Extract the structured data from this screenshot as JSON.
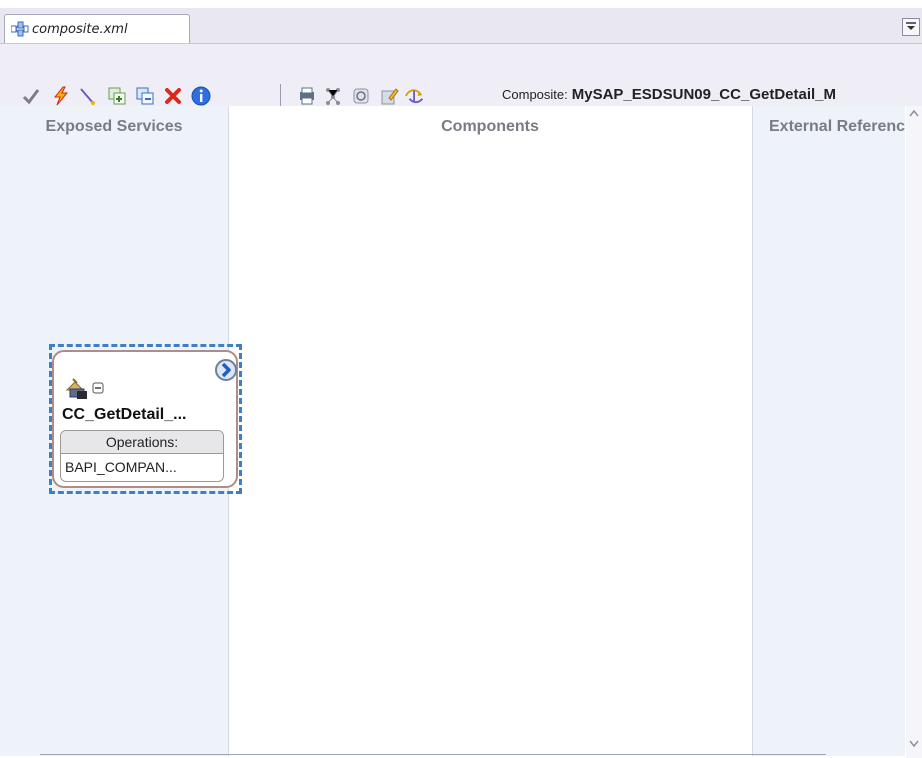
{
  "tab": {
    "label": "composite.xml"
  },
  "toolbar": {
    "composite_prefix": "Composite:",
    "composite_name": "MySAP_ESDSUN09_CC_GetDetail_M",
    "buttons": [
      {
        "icon": "check-icon"
      },
      {
        "icon": "lightning-icon"
      },
      {
        "icon": "wire-icon"
      },
      {
        "icon": "add-component-icon"
      },
      {
        "icon": "copy-icon"
      },
      {
        "icon": "delete-icon"
      },
      {
        "icon": "info-icon"
      },
      {
        "icon": "print-icon"
      },
      {
        "icon": "layout-icon"
      },
      {
        "icon": "refresh-icon"
      },
      {
        "icon": "edit-icon"
      },
      {
        "icon": "deploy-icon"
      }
    ]
  },
  "lanes": {
    "left_title": "Exposed Services",
    "middle_title": "Components",
    "right_title": "External References"
  },
  "component": {
    "name": "CC_GetDetail_...",
    "operations_label": "Operations:",
    "operation": "BAPI_COMPAN..."
  },
  "colors": {
    "selection": "#3f7fc7",
    "component_border": "#b18b86",
    "lane_bg": "#eef3f9"
  }
}
